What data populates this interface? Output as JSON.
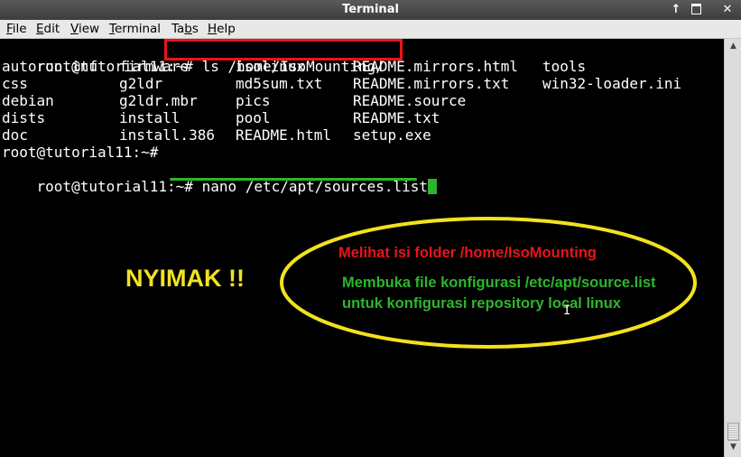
{
  "window": {
    "title": "Terminal",
    "buttons": {
      "up": "↑",
      "close": "✕"
    }
  },
  "menu": {
    "items": [
      {
        "pre": "",
        "u": "F",
        "post": "ile"
      },
      {
        "pre": "",
        "u": "E",
        "post": "dit"
      },
      {
        "pre": "",
        "u": "V",
        "post": "iew"
      },
      {
        "pre": "",
        "u": "T",
        "post": "erminal"
      },
      {
        "pre": "Ta",
        "u": "b",
        "post": "s"
      },
      {
        "pre": "",
        "u": "H",
        "post": "elp"
      }
    ]
  },
  "terminal": {
    "prompt": "root@tutorial11:~# ",
    "command1": "ls /home/IsoMounting/",
    "listing": [
      [
        "autorun.inf",
        "firmware",
        "isolinux",
        "README.mirrors.html",
        "tools"
      ],
      [
        "css",
        "g2ldr",
        "md5sum.txt",
        "README.mirrors.txt",
        "win32-loader.ini"
      ],
      [
        "debian",
        "g2ldr.mbr",
        "pics",
        "README.source",
        ""
      ],
      [
        "dists",
        "install",
        "pool",
        "README.txt",
        ""
      ],
      [
        "doc",
        "install.386",
        "README.html",
        "setup.exe",
        ""
      ]
    ],
    "prompt_empty": "root@tutorial11:~#",
    "command2": "nano /etc/apt/sources.list"
  },
  "annotations": {
    "nyimak": "NYIMAK !!",
    "note_red": "Melihat isi folder /home/IsoMounting",
    "note_green_line1": "Membuka file konfigurasi /etc/apt/source.list",
    "note_green_line2": "untuk konfigurasi repository local linux"
  },
  "colors": {
    "highlight_red": "#e8141a",
    "highlight_green": "#2db52d",
    "ellipse_yellow": "#f2e21e"
  }
}
